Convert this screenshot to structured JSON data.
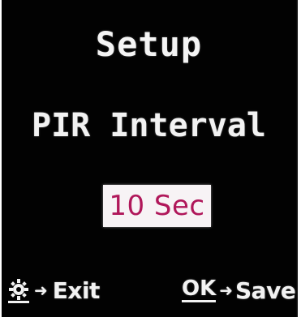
{
  "screen": {
    "title": "Setup",
    "menu_item": "PIR Interval",
    "value": "10 Sec"
  },
  "footer": {
    "exit": {
      "key_icon": "gear-icon",
      "arrow": "➜",
      "label": "Exit"
    },
    "save": {
      "key_label": "OK",
      "arrow": "➜",
      "label": "Save"
    }
  },
  "colors": {
    "background": "#020202",
    "text": "#f2f2f2",
    "value_box": "#f7f3f5",
    "value_text": "#b0175a"
  }
}
